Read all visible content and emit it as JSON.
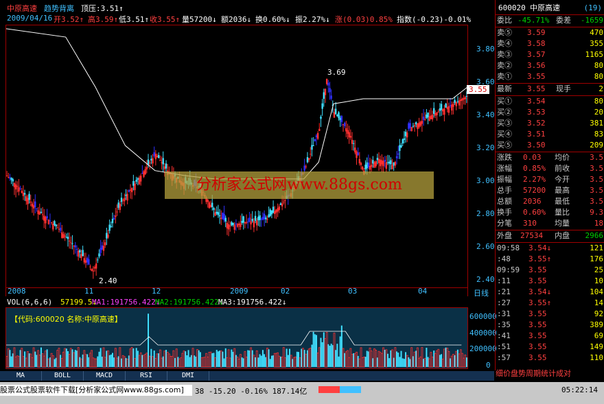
{
  "info": {
    "stock_name": "中原高速",
    "indicator": "趋势背离",
    "pressure_label": "顶压:3.51↑",
    "date": "2009/04/16",
    "open": "开3.52↑",
    "high": "高3.59↑",
    "low": "低3.51↑",
    "close": "收3.55↑",
    "volume": "量57200↓",
    "amount": "额2036↓",
    "turnover": "换0.60%↓",
    "amplitude": "振2.27%↓",
    "change": "涨(0.03)0.85%",
    "index": "指数(-0.23)-0.01%"
  },
  "price_axis": [
    "3.80",
    "3.60",
    "3.40",
    "3.20",
    "3.00",
    "2.80",
    "2.60",
    "2.40"
  ],
  "current_price_tag": "3.55",
  "annotations": {
    "high": "3.69",
    "low": "2.40"
  },
  "date_labels": [
    "2008",
    "11",
    "12",
    "2009",
    "02",
    "03",
    "04"
  ],
  "period_label": "日线",
  "vol_header": {
    "name": "VOL(6,6,6)",
    "v": "57199.5↓",
    "ma1": "MA1:191756.422↓",
    "ma2": "MA2:191756.422↓",
    "ma3": "MA3:191756.422↓"
  },
  "vol_box": "【代码:600020 名称:中原高速】",
  "vol_axis": [
    "600000",
    "400000",
    "200000",
    "0"
  ],
  "watermark": "分析家公式网www.88gs.com",
  "panel": {
    "code": "600020",
    "name": "中原高速",
    "num": "(19)",
    "ratio_label": "委比",
    "ratio_value": "-45.71%",
    "diff_label": "委差",
    "diff_value": "-1659",
    "sells": [
      {
        "label": "卖⑤",
        "price": "3.59",
        "vol": "470"
      },
      {
        "label": "卖④",
        "price": "3.58",
        "vol": "355"
      },
      {
        "label": "卖③",
        "price": "3.57",
        "vol": "1165"
      },
      {
        "label": "卖②",
        "price": "3.56",
        "vol": "80"
      },
      {
        "label": "卖①",
        "price": "3.55",
        "vol": "80"
      }
    ],
    "latest_label": "最新",
    "latest_value": "3.55",
    "now_label": "现手",
    "now_value": "2",
    "buys": [
      {
        "label": "买①",
        "price": "3.54",
        "vol": "80"
      },
      {
        "label": "买②",
        "price": "3.53",
        "vol": "20"
      },
      {
        "label": "买③",
        "price": "3.52",
        "vol": "381"
      },
      {
        "label": "买④",
        "price": "3.51",
        "vol": "83"
      },
      {
        "label": "买⑤",
        "price": "3.50",
        "vol": "209"
      }
    ],
    "stats": [
      {
        "l1": "涨跌",
        "v1": "0.03",
        "l2": "均价",
        "v2": "3.5"
      },
      {
        "l1": "涨幅",
        "v1": "0.85%",
        "l2": "前收",
        "v2": "3.5"
      },
      {
        "l1": "振幅",
        "v1": "2.27%",
        "l2": "今开",
        "v2": "3.5"
      },
      {
        "l1": "总手",
        "v1": "57200",
        "l2": "最高",
        "v2": "3.5"
      },
      {
        "l1": "总额",
        "v1": "2036",
        "l2": "最低",
        "v2": "3.5"
      },
      {
        "l1": "换手",
        "v1": "0.60%",
        "l2": "量比",
        "v2": "9.3"
      },
      {
        "l1": "分笔",
        "v1": "310",
        "l2": "均量",
        "v2": "18"
      }
    ],
    "outer_label": "外盘",
    "outer_value": "27534",
    "inner_label": "内盘",
    "inner_value": "2966",
    "ticks": [
      {
        "t": "09:58",
        "p": "3.54↓",
        "v": "121"
      },
      {
        "t": ":48",
        "p": "3.55↑",
        "v": "176"
      },
      {
        "t": "09:59",
        "p": "3.55",
        "v": "25"
      },
      {
        "t": ":11",
        "p": "3.55",
        "v": "10"
      },
      {
        "t": ":21",
        "p": "3.54↓",
        "v": "104"
      },
      {
        "t": ":27",
        "p": "3.55↑",
        "v": "14"
      },
      {
        "t": ":31",
        "p": "3.55",
        "v": "92"
      },
      {
        "t": ":35",
        "p": "3.55",
        "v": "389"
      },
      {
        "t": ":41",
        "p": "3.55",
        "v": "69"
      },
      {
        "t": ":51",
        "p": "3.55",
        "v": "149"
      },
      {
        "t": ":57",
        "p": "3.55",
        "v": "110"
      }
    ],
    "bottom_tabs": "细价盘势周期统计成对"
  },
  "tabs": [
    "MA",
    "BOLL",
    "MACD",
    "RSI",
    "DMI"
  ],
  "status": {
    "ticker": "股票公式股票软件下载[分析家公式网www.88gs.com]",
    "quote": "38 -15.20 -0.16% 187.14亿",
    "time": "05:22:14"
  }
}
